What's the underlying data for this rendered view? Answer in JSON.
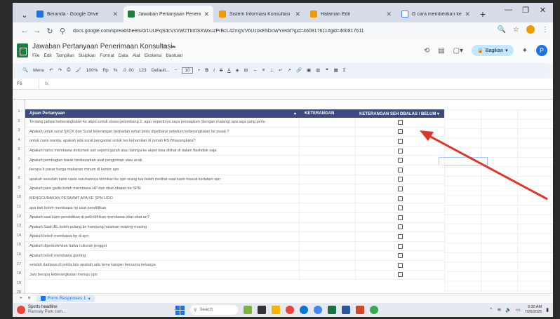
{
  "browser": {
    "tabs": [
      {
        "title": "Beranda - Google Drive",
        "color": "#1a73e8",
        "active": false
      },
      {
        "title": "Jawaban Pertanyaan Penerim",
        "color": "#188038",
        "active": true
      },
      {
        "title": "Sistem Informasi Konsultasi",
        "color": "#f29900",
        "active": false
      },
      {
        "title": "Halaman Edit",
        "color": "#f29900",
        "active": false
      },
      {
        "title": "G cara memberikan keterangan",
        "color": "#ffffff",
        "active": false
      }
    ],
    "url": "docs.google.com/spreadsheets/d/1UUFqSdcVsVW2Tbr0SXWxuzPrBcL42mgVV6UzokE5DcWY/edit?gid=460817611#gid=460817611"
  },
  "sheet": {
    "title": "Jawaban Pertanyaan Penerimaan Konsultasi",
    "menus": [
      "File",
      "Edit",
      "Tampilan",
      "Sisipkan",
      "Format",
      "Data",
      "Alat",
      "Ekstensi",
      "Bantuan"
    ],
    "share_label": "Bagikan",
    "avatar_letter": "P",
    "toolbar": {
      "search": "Menu",
      "zoom": "100%",
      "currency": "Rp",
      "percent": "%",
      "decimal": ".0 .00",
      "number_format": "123",
      "font": "Default...",
      "font_size": "10"
    },
    "name_box": "F6",
    "fx": "fx"
  },
  "table": {
    "headers": {
      "question": "Ajuan Pertanyaan",
      "note": "KETERANGAN",
      "status": "KETERANGAN SEH DBALAS / BELUM"
    },
    "rows": [
      "Tentang jadwal keberangkatan ke akpol untuk siswa gelombang 2, agar sepertinya saya persiapkan (dengan matang) apa saja yang perlu",
      "Apakah untuk surat SKCK dan Surat keterangan berbadan sehat perlu dipelbarui sebelum keberangkatan ke pusat ?",
      "untuk casis wanita, apakah ada surat pengantar untuk tes kehamilan di rumah RS Bhayangkara?",
      "Apakah harus membawa dokumen asli seperti ijazah atau lainnya ke akpol bisa dilihat di dalam flashdisk saja",
      "Apakah pembagian barak berdasarkan asal pengiriman atau acak",
      "berapa k pasar harga makanan minum di kantor spn",
      "apakah sesudah kami casis suruhannya kirimkan ke spn orang tua boleh melihat saat kami masuk kedalam spn",
      "Apakah pare gadis boleh membawa HP dan obat-obatan ke SPN",
      "MENGGUNAKAN PESAWAT APA KE SPN LIDO",
      "apa kah boleh membawa hp saat pendidikan",
      "Apakah saat kami pendidikan di pelbrikfrikan membawa obat obat an?",
      "Apakah Saat IBL boleh pulang ke kampung halaman masing-masing",
      "Apakah boleh membawa hp di spn",
      "Apakah diperbolehkan bawa cukuran jenggot",
      "Apakah boleh membawa gunting",
      "setelah dadiawa di polda lalu apakah ada temu kangen bersama keluarga",
      "Jam berapa keberangkatan menuju spn"
    ],
    "row_numbers": [
      "1",
      "2",
      "3",
      "4",
      "5",
      "6",
      "7",
      "8",
      "9",
      "10",
      "11",
      "12",
      "13",
      "14",
      "15",
      "16",
      "17",
      "18",
      "19",
      "20"
    ]
  },
  "sheet_tabs": {
    "active": "Form Responses 1"
  },
  "taskbar": {
    "weather_title": "Sports headline",
    "weather_sub": "Ramsay Park com...",
    "search": "Search",
    "time": "9:30 AM",
    "date": "7/26/2025"
  },
  "annotation": {
    "color": "#e0352b"
  }
}
